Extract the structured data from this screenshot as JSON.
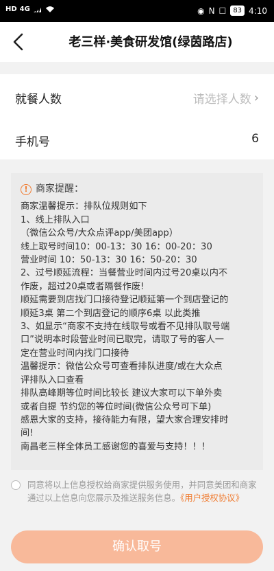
{
  "status_bar": {
    "left_badges": [
      "HD",
      "4G"
    ],
    "battery": "83",
    "time": "4:10"
  },
  "nav": {
    "title": "老三样·美食研发馆(绿茵路店)"
  },
  "form": {
    "diners": {
      "label": "就餐人数",
      "placeholder": "请选择人数"
    },
    "phone": {
      "label": "手机号",
      "value": "6"
    }
  },
  "notice": {
    "title": "商家提醒：",
    "lines": [
      "商家温馨提示：排队位规则如下",
      "1、线上排队入口",
      "（微信公众号/大众点评app/美团app）",
      "线上取号时间10：00-13：30 16：00-20：30",
      "营业时间 10：50-13：30 16：50-20：30",
      "2、过号顺延流程：当餐营业时间内过号20桌以内不",
      "作废，超过20桌或者隔餐作废!",
      "顺延需要到店找门口接待登记顺延第一个到店登记的",
      "顺延3桌 第二个到店登记的顺序6桌 以此类推",
      "3、如显示“商家不支持在线取号或看不见排队取号端",
      "口”说明本时段营业时间已取完，请取了号的客人一",
      "定在营业时间内找门口接待",
      "温馨提示：微信公众号可查看排队进度/或在大众点",
      "评排队入口查看",
      "排队高峰期等位时间比较长 建议大家可以下单外卖",
      "或者自提 节约您的等位时间(微信公众号可下单)",
      "感恩大家的支持，接待能力有限，望大家合理安排时",
      "间!",
      "南昌老三样全体员工感谢您的喜爱与支持！！！"
    ]
  },
  "consent": {
    "text": "同意将以上信息授权给商家提供服务使用，并同意美团和商家通过以上信息向您展示及推送服务信息。",
    "link": "《用户授权协议》"
  },
  "confirm_button": {
    "label": "确认取号"
  },
  "colors": {
    "accent": "#f07a2e",
    "button": "#f8b99a"
  }
}
